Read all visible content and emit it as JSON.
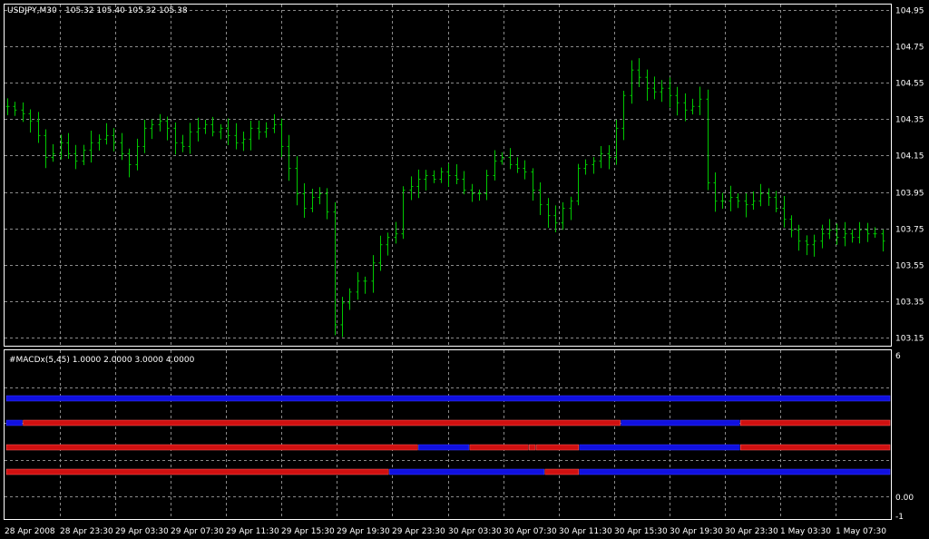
{
  "price_panel": {
    "symbol_label": "USDJPY,M30",
    "ohlc_label": "105.32 105.40 105.32 105.38",
    "price_ticks": [
      "104.95",
      "104.75",
      "104.55",
      "104.35",
      "104.15",
      "103.95",
      "103.75",
      "103.55",
      "103.35",
      "103.15"
    ],
    "bar_color": "#00c800"
  },
  "indicator_panel": {
    "label": "#MACDx(5,45) 1.0000 2.0000 3.0000 4.0000",
    "ticks": [
      "6",
      "0.00",
      "-1"
    ],
    "colors": {
      "up": "#1010e0",
      "down": "#d01010"
    }
  },
  "time_axis": {
    "labels": [
      "28 Apr 2008",
      "28 Apr 23:30",
      "29 Apr 03:30",
      "29 Apr 07:30",
      "29 Apr 11:30",
      "29 Apr 15:30",
      "29 Apr 19:30",
      "29 Apr 23:30",
      "30 Apr 03:30",
      "30 Apr 07:30",
      "30 Apr 11:30",
      "30 Apr 15:30",
      "30 Apr 19:30",
      "30 Apr 23:30",
      "1 May 03:30",
      "1 May 07:30"
    ]
  },
  "chart_data": [
    {
      "type": "line",
      "series": [
        {
          "values": [
            104.42,
            104.4,
            104.38,
            104.34,
            104.26,
            104.14,
            104.16,
            104.22,
            104.16,
            104.12,
            104.18,
            104.22,
            104.24,
            104.26,
            104.22,
            104.16,
            104.1,
            104.2,
            104.3,
            104.32,
            104.34,
            104.3,
            104.22,
            104.2,
            104.28,
            104.3,
            104.32,
            104.28,
            104.3,
            104.26,
            104.22,
            104.24,
            104.3,
            104.28,
            104.3,
            104.32,
            104.2,
            104.08,
            103.94,
            103.86,
            103.92,
            103.94,
            103.84,
            103.22,
            103.34,
            103.4,
            103.46,
            103.46,
            103.56,
            103.66,
            103.7,
            103.72,
            103.96,
            103.98,
            104.02,
            104.04,
            104.02,
            104.06,
            104.04,
            104.02,
            103.96,
            103.94,
            103.94,
            104.04,
            104.12,
            104.14,
            104.1,
            104.08,
            104.06,
            103.96,
            103.88,
            103.82,
            103.78,
            103.86,
            103.9,
            104.08,
            104.1,
            104.12,
            104.16,
            104.14,
            104.3,
            104.48,
            104.62,
            104.58,
            104.52,
            104.5,
            104.52,
            104.48,
            104.44,
            104.4,
            104.42,
            104.46,
            104.0,
            103.9,
            103.9,
            103.92,
            103.9,
            103.88,
            103.9,
            103.94,
            103.92,
            103.86,
            103.8,
            103.74,
            103.68,
            103.66,
            103.68,
            103.72,
            103.74,
            103.7
          ]
        },
        {
          "values": [
            103.72,
            103.7,
            103.74,
            103.72,
            103.72,
            103.68
          ]
        }
      ],
      "ylim": [
        103.1,
        104.98
      ]
    },
    {
      "type": "heatmap",
      "rows": [
        {
          "name": "1.0000",
          "segments": [
            [
              0,
              1,
              "up"
            ]
          ]
        },
        {
          "name": "2.0000",
          "segments": [
            [
              0,
              0.019,
              "up"
            ],
            [
              0.019,
              0.695,
              "down"
            ],
            [
              0.695,
              0.83,
              "up"
            ],
            [
              0.83,
              1,
              "down"
            ]
          ]
        },
        {
          "name": "3.0000",
          "segments": [
            [
              0,
              0.466,
              "down"
            ],
            [
              0.466,
              0.524,
              "up"
            ],
            [
              0.524,
              0.591,
              "down"
            ],
            [
              0.591,
              0.599,
              "down"
            ],
            [
              0.599,
              0.648,
              "down"
            ],
            [
              0.648,
              0.83,
              "up"
            ],
            [
              0.83,
              1,
              "down"
            ]
          ]
        },
        {
          "name": "4.0000",
          "segments": [
            [
              0,
              0.433,
              "down"
            ],
            [
              0.433,
              0.609,
              "up"
            ],
            [
              0.609,
              0.648,
              "down"
            ],
            [
              0.648,
              1,
              "up"
            ]
          ]
        }
      ]
    }
  ]
}
